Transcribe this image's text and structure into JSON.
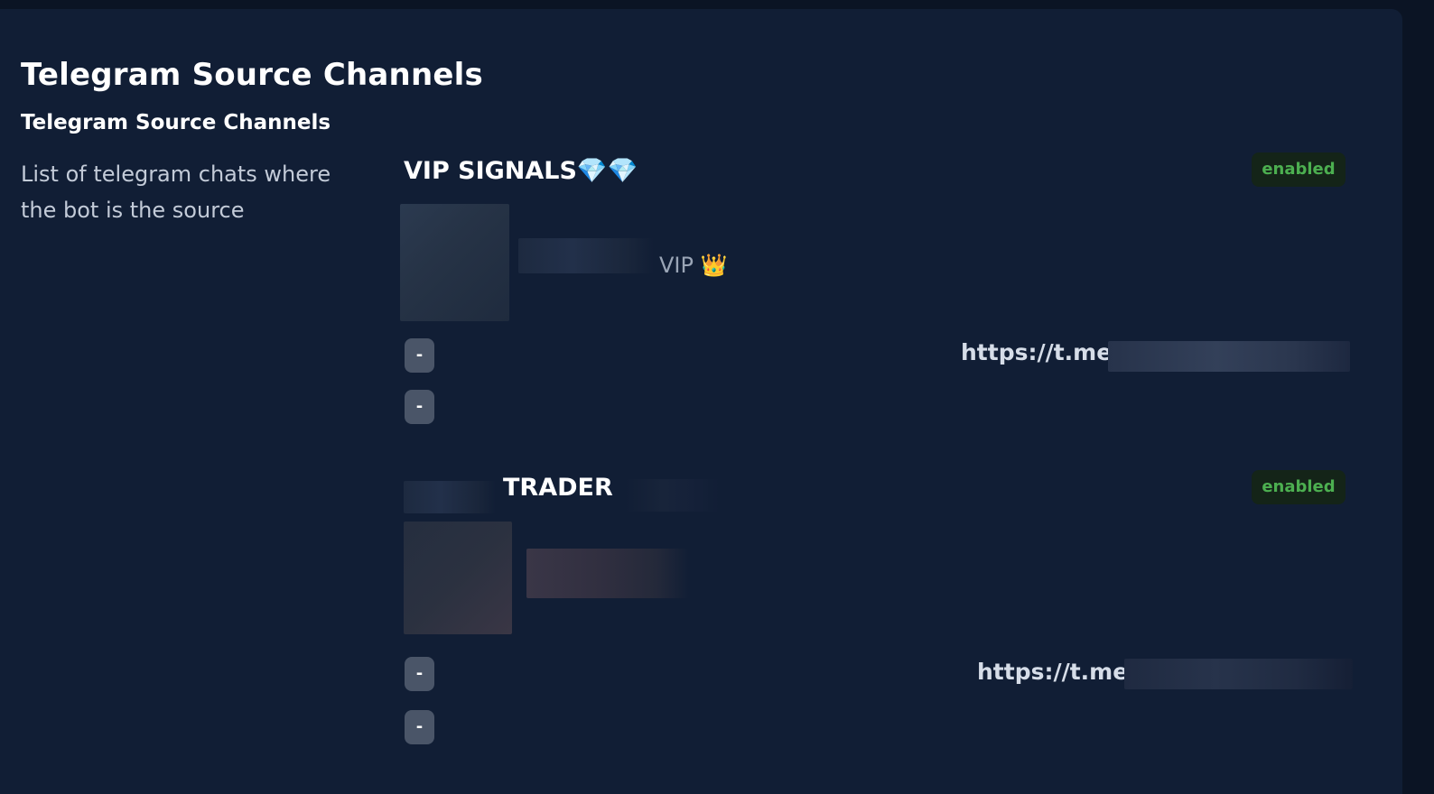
{
  "page": {
    "title": "Telegram Source Channels"
  },
  "section": {
    "title": "Telegram Source Channels",
    "description": "List of telegram chats where the bot is the source"
  },
  "channels": [
    {
      "name": "VIP SIGNALS💎💎",
      "status": "enabled",
      "subtitle": "VIP 👑",
      "button_1": "-",
      "button_2": "-",
      "link_prefix": "https://t.me/"
    },
    {
      "name": "TRADER",
      "status": "enabled",
      "subtitle": "",
      "button_1": "-",
      "button_2": "-",
      "link_prefix": "https://t.me/"
    }
  ],
  "colors": {
    "background": "#0b1424",
    "panel": "#111e35",
    "status_enabled_text": "#4caf50",
    "status_enabled_bg": "#142418",
    "button_bg": "#4a5568"
  }
}
